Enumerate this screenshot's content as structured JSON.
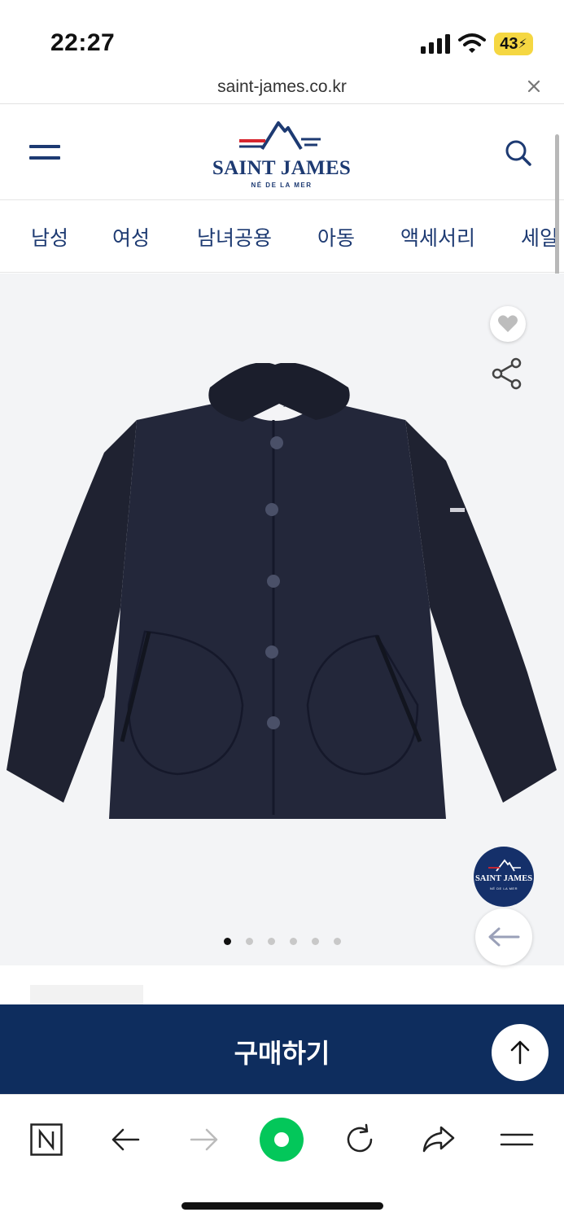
{
  "status": {
    "time": "22:27",
    "battery": "43"
  },
  "browser": {
    "url": "saint-james.co.kr"
  },
  "header": {
    "logo_name": "SAINT JAMES",
    "logo_tagline": "NÉ DE LA MER"
  },
  "nav": {
    "categories": [
      {
        "label": "남성"
      },
      {
        "label": "여성"
      },
      {
        "label": "남녀공용"
      },
      {
        "label": "아동"
      },
      {
        "label": "액세서리"
      },
      {
        "label": "세일"
      }
    ]
  },
  "gallery": {
    "image_count": 6,
    "active_index": 0,
    "badge_name": "SAINT JAMES",
    "badge_tagline": "NÉ DE LA MER"
  },
  "purchase": {
    "button_label": "구매하기"
  },
  "colors": {
    "brand_navy": "#1d3a72",
    "buy_bar": "#0e2d5e",
    "accent_red": "#d7262e",
    "gallery_bg": "#f3f4f6",
    "naver_green": "#03c75a"
  },
  "toolbar_icons": [
    "naver-n-icon",
    "back-arrow-icon",
    "forward-arrow-icon",
    "green-dot-icon",
    "reload-icon",
    "share-arrow-icon",
    "menu-icon"
  ]
}
